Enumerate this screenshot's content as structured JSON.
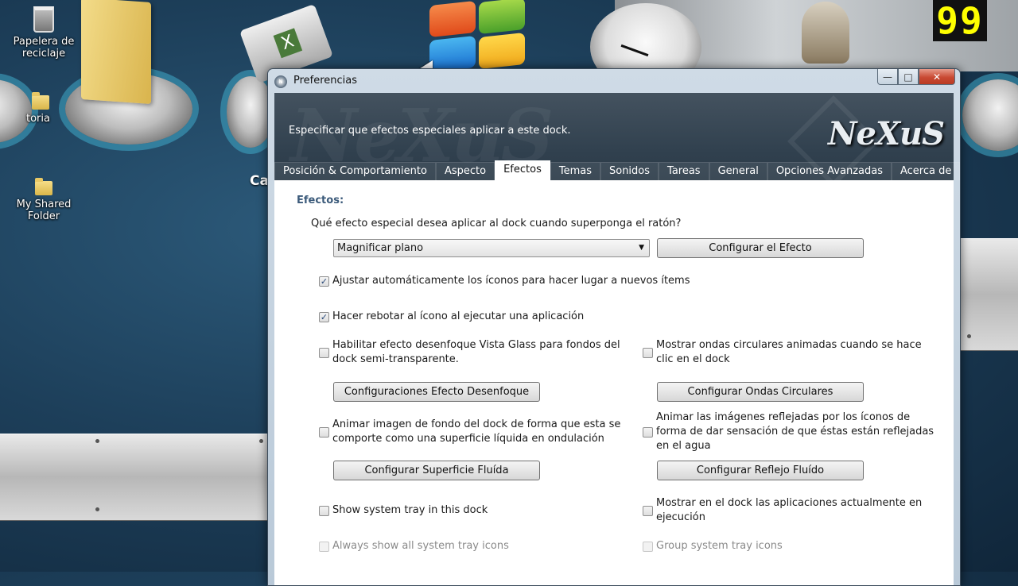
{
  "desktop": {
    "icons": [
      {
        "label": "Papelera de\nreciclaje"
      },
      {
        "label": "toria"
      },
      {
        "label": "My Shared Folder"
      }
    ],
    "partial_label": "Ca",
    "counter": "99"
  },
  "window": {
    "title": "Preferencias",
    "title_icon": "nexus-icon",
    "caption": {
      "minimize": "—",
      "maximize": "□",
      "close": "✕"
    }
  },
  "header": {
    "subtitle": "Especificar que efectos especiales aplicar a este dock.",
    "logo": "NeXuS",
    "bg_text": "NeXuS"
  },
  "tabs": [
    {
      "label": "Posición & Comportamiento",
      "active": false
    },
    {
      "label": "Aspecto",
      "active": false
    },
    {
      "label": "Efectos",
      "active": true
    },
    {
      "label": "Temas",
      "active": false
    },
    {
      "label": "Sonidos",
      "active": false
    },
    {
      "label": "Tareas",
      "active": false
    },
    {
      "label": "General",
      "active": false
    },
    {
      "label": "Opciones Avanzadas",
      "active": false
    },
    {
      "label": "Acerca de",
      "active": false
    }
  ],
  "effects": {
    "section_title": "Efectos:",
    "question": "Qué efecto especial desea aplicar al dock cuando superponga el ratón?",
    "effect_select": {
      "value": "Magnificar plano"
    },
    "configure_effect": "Configurar el Efecto",
    "auto_adjust": {
      "checked": true,
      "label": "Ajustar automáticamente los íconos para hacer lugar a nuevos ítems"
    },
    "bounce": {
      "checked": true,
      "label": "Hacer rebotar al ícono al ejecutar una aplicación"
    },
    "blur": {
      "checked": false,
      "label": "Habilitar efecto desenfoque Vista Glass para fondos del\ndock semi-transparente."
    },
    "ripples": {
      "checked": false,
      "label": "Mostrar ondas circulares animadas cuando se hace\nclic en el dock"
    },
    "blur_settings": "Configuraciones Efecto Desenfoque",
    "ripples_settings": "Configurar Ondas Circulares",
    "liquid_bg": {
      "checked": false,
      "label": "Animar imagen de fondo del dock de forma que esta se\ncomporte como una superficie líquida en ondulación"
    },
    "liquid_reflect": {
      "checked": false,
      "label": "Animar las imágenes reflejadas por los íconos de\nforma de dar sensación de que éstas están reflejadas\nen el agua"
    },
    "fluid_surface": "Configurar Superficie Fluída",
    "fluid_reflect": "Configurar Reflejo Fluído",
    "tray": {
      "checked": false,
      "label": "Show system tray in this dock"
    },
    "running": {
      "checked": false,
      "label": "Mostrar en el dock las aplicaciones actualmente en\nejecución"
    },
    "always_tray": {
      "checked": false,
      "disabled": true,
      "label": "Always show all system tray icons"
    },
    "group_tray": {
      "checked": false,
      "disabled": true,
      "label": "Group system tray icons"
    }
  }
}
